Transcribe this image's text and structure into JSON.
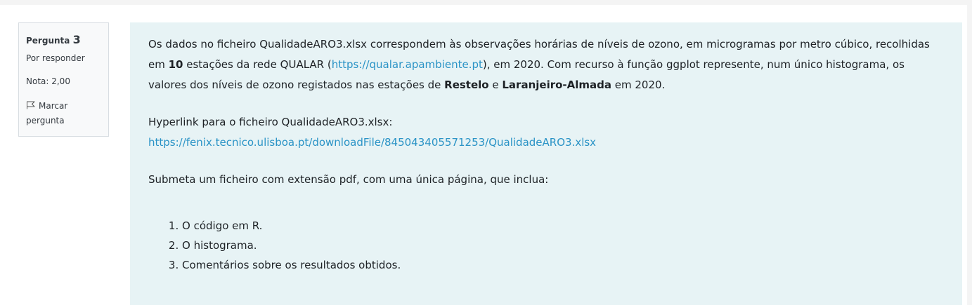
{
  "question_info": {
    "label": "Pergunta",
    "number": "3",
    "state": "Por responder",
    "grade": "Nota: 2,00",
    "flag_label": "Marcar pergunta"
  },
  "question_text": {
    "p1_part1": "Os dados no ficheiro QualidadeARO3.xlsx correspondem às observações horárias de níveis de ozono, em microgramas por metro cúbico, recolhidas em ",
    "p1_bold_count": "10",
    "p1_part2": " estações da rede QUALAR (",
    "p1_link": "https://qualar.apambiente.pt",
    "p1_part3": "), em 2020. Com recurso à função ggplot represente, num único histograma, os valores dos níveis de ozono registados nas estações de ",
    "p1_bold_station1": "Restelo",
    "p1_part4": " e ",
    "p1_bold_station2": "Laranjeiro-Almada",
    "p1_part5": " em 2020.",
    "hyperlink_label": "Hyperlink para o ficheiro QualidadeARO3.xlsx:",
    "hyperlink_url": "https://fenix.tecnico.ulisboa.pt/downloadFile/845043405571253/QualidadeARO3.xlsx",
    "submit_instruction": "Submeta um ficheiro com extensão pdf, com uma única página, que inclua:",
    "list_items": [
      "O código em R.",
      "O histograma.",
      "Comentários sobre os resultados obtidos."
    ]
  },
  "colors": {
    "content_bg": "#e7f3f5",
    "link": "#2a93c6",
    "info_bg": "#f8f9fa"
  }
}
